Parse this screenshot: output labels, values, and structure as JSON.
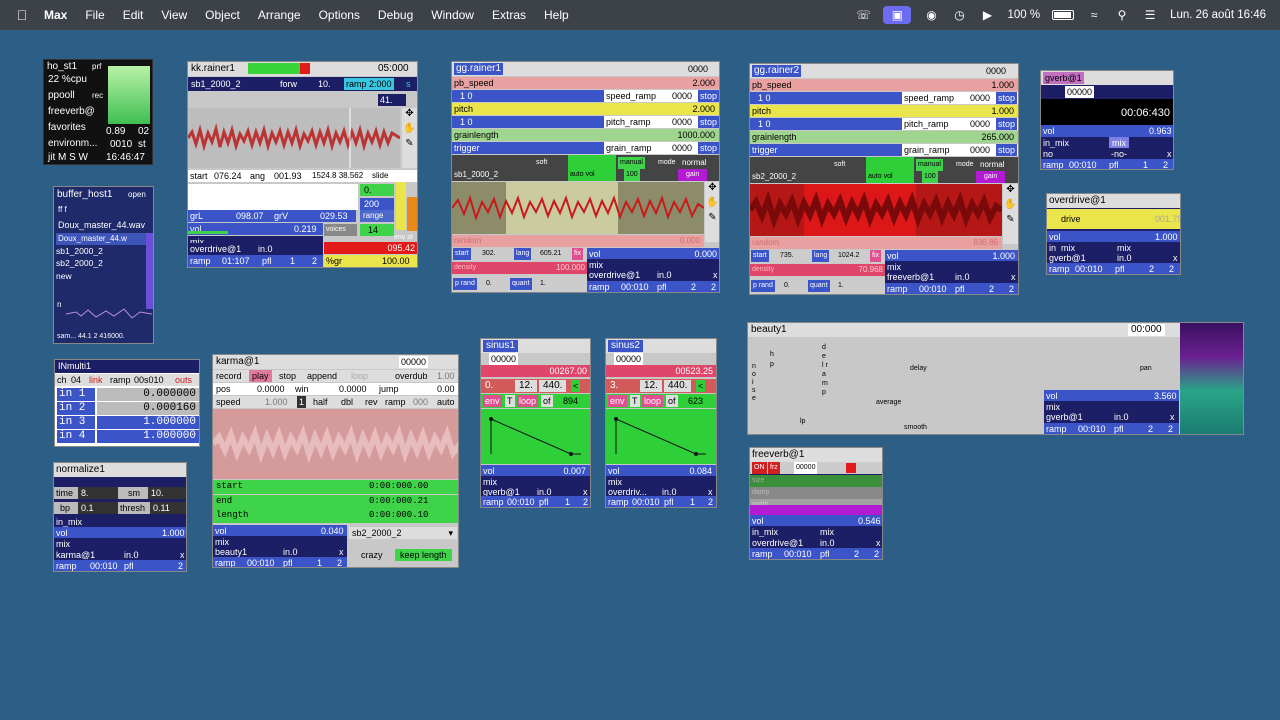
{
  "menubar": {
    "app": "Max",
    "items": [
      "File",
      "Edit",
      "View",
      "Object",
      "Arrange",
      "Options",
      "Debug",
      "Window",
      "Extras",
      "Help"
    ],
    "battery": "100 %",
    "datetime": "Lun. 26 août  16:46"
  },
  "host": {
    "name": "ho_st1",
    "cpu": "22 %cpu",
    "pr": "prf",
    "ppool": "ppooll",
    "rec": "rec",
    "fv": "freeverb@",
    "fav": "favorites",
    "env": "environm...",
    "jit": "jit M S W",
    "time": "16:46:47",
    "v1": "0.89",
    "v2": "02",
    "v3": "0010",
    "st": "st"
  },
  "buffer": {
    "title": "buffer_host1",
    "open": "open",
    "ff": "ff  f",
    "items": [
      "Doux_master_44.wav",
      "Doux_master_44.w",
      "sb1_2000_2",
      "sb2_2000_2",
      "new"
    ],
    "n": "n",
    "foot": "sam...  44.1  2  416000."
  },
  "kk": {
    "title": "kk.rainer1",
    "time": "05:000",
    "file": "sb1_2000_2",
    "dir": "forw",
    "n": "10.",
    "ramp": "ramp 2:000",
    "s": "s",
    "n41": "41.",
    "start": "start",
    "startv": "076.24",
    "ang": "ang",
    "angv": "001.93",
    "nums": "1524.8  38.562",
    "slide": "slide",
    "zero": "0.",
    "grL": "grL",
    "grLv": "098.07",
    "grV": "grV",
    "grVv": "029.53",
    "v200": "200",
    "range": "range",
    "vol": "vol",
    "volv": "0.219",
    "mix": "mix",
    "voices": "voices",
    "v14": "14",
    "od": "overdrive@1",
    "in0": "in.0",
    "ramp2": "ramp",
    "rampv": "01:107",
    "pfl": "pfl",
    "one": "1",
    "two": "2",
    "gr": "%gr",
    "grv": "100.00",
    "val95": "095.42",
    "env": "env  st"
  },
  "gg1": {
    "title": "gg.rainer1",
    "top": "0000",
    "pb": "pb_speed",
    "pbv": "2.000",
    "one": "1  0",
    "sr": "speed_ramp",
    "srv": "0000",
    "stop": "stop",
    "pitch": "pitch",
    "pitchv": "2.000",
    "pr": "pitch_ramp",
    "prv": "0000",
    "gl": "grainlength",
    "glv": "1000.000",
    "trig": "trigger",
    "gr": "grain_ramp",
    "grv": "0000",
    "soft": "soft",
    "manual": "manual",
    "mode": "mode",
    "normal": "normal",
    "file": "sb1_2000_2",
    "autovol": "auto vol",
    "v100": "100",
    "gain": "gain",
    "random": "random",
    "randv": "0.000",
    "start": "start",
    "startv": "302.",
    "lang": "lang",
    "langv": "605.21",
    "fix": "fix",
    "vol": "vol",
    "volv": "0.000",
    "density": "density",
    "dv": "100.000",
    "mix": "mix",
    "od": "overdrive@1",
    "in0": "in.0",
    "prand": "p rand",
    "pr0": "0.",
    "quant": "quant",
    "q1": "1.",
    "ramp": "ramp",
    "rampv": "00:010",
    "pfl": "pfl",
    "n2": "2",
    "x": "x"
  },
  "gg2": {
    "title": "gg.rainer2",
    "top": "0000",
    "pb": "pb_speed",
    "pbv": "1.000",
    "one": "1  0",
    "sr": "speed_ramp",
    "srv": "0000",
    "stop": "stop",
    "pitch": "pitch",
    "pitchv": "1.000",
    "pr": "pitch_ramp",
    "prv": "0000",
    "gl": "grainlength",
    "glv": "265.000",
    "trig": "trigger",
    "gr": "grain_ramp",
    "grv": "0000",
    "soft": "soft",
    "manual": "manual",
    "mode": "mode",
    "normal": "normal",
    "file": "sb2_2000_2",
    "autovol": "auto vol",
    "v100": "100",
    "gain": "gain",
    "random": "random",
    "randv": "836.86",
    "start": "start",
    "startv": "735.",
    "lang": "lang",
    "langv": "1024.2",
    "fix": "fix",
    "vol": "vol",
    "volv": "1.000",
    "density": "density",
    "dv": "70.968",
    "mix": "mix",
    "od": "freeverb@1",
    "in0": "in.0",
    "prand": "p rand",
    "pr0": "0.",
    "quant": "quant",
    "q1": "1.",
    "ramp": "ramp",
    "rampv": "00:010",
    "pfl": "pfl",
    "n2": "2",
    "x": "x"
  },
  "gverb": {
    "title": "gverb@1",
    "v1": "00000",
    "time": "00:06:430",
    "vol": "vol",
    "volv": "0.963",
    "inmix": "in_mix",
    "mix": "mix",
    "no": "no",
    "no2": "-no-",
    "x": "x",
    "ramp": "ramp",
    "rampv": "00:010",
    "pfl": "pfl",
    "n1": "1",
    "n2": "2"
  },
  "over": {
    "title": "overdrive@1",
    "drive": "drive",
    "dv": "001.79",
    "vol": "vol",
    "volv": "1.000",
    "inmix": "in_mix",
    "mix": "mix",
    "gv": "gverb@1",
    "in0": "in.0",
    "x": "x",
    "ramp": "ramp",
    "rampv": "00:010",
    "pfl": "pfl",
    "n1": "2",
    "n2": "2"
  },
  "inm": {
    "title": "INmulti1",
    "ch": "ch",
    "chv": "04",
    "link": "link",
    "ramp": "ramp",
    "rampv": "00s010",
    "outs": "outs",
    "ins": [
      {
        "l": "in 1",
        "v": "0.000000"
      },
      {
        "l": "in 2",
        "v": "0.000160"
      },
      {
        "l": "in 3",
        "v": "1.000000"
      },
      {
        "l": "in 4",
        "v": "1.000000"
      }
    ]
  },
  "norm": {
    "title": "normalize1",
    "time": "time",
    "timev": "8.",
    "sm": "sm",
    "smv": "10.",
    "bp": "bp",
    "bpv": "0.1",
    "thresh": "thresh",
    "threshv": "0.11",
    "inmix": "in_mix",
    "vol": "vol",
    "volv": "1.000",
    "mix": "mix",
    "dest": "karma@1",
    "in0": "in.0",
    "x": "x",
    "ramp": "ramp",
    "rampv": "00:010",
    "pfl": "pfl",
    "n2": "2"
  },
  "karma": {
    "title": "karma@1",
    "top": "00000",
    "record": "record",
    "play": "play",
    "stop": "stop",
    "append": "append",
    "loop": "loop",
    "overdub": "overdub",
    "ov": "1.00",
    "pos": "pos",
    "posv": "0.0000",
    "win": "win",
    "winv": "0.0000",
    "jump": "jump",
    "jumpv": "0.00",
    "speed": "speed",
    "speedv": "1.000",
    "one": "1",
    "half": "half",
    "dbl": "dbl",
    "rev": "rev",
    "ramp": "ramp",
    "rampv": "000",
    "auto": "auto",
    "start": "start",
    "startv": "0:00:000.00",
    "end": "end",
    "endv": "0:00:000.21",
    "length": "length",
    "lengthv": "0:00:000.10",
    "vol": "vol",
    "volv": "0.040",
    "mix": "mix",
    "dest": "beauty1",
    "in0": "in.0",
    "x": "x",
    "rampl": "ramp",
    "rampl2": "00:010",
    "pfl": "pfl",
    "n1": "1",
    "n2": "2",
    "file": "sb2_2000_2",
    "crazy": "crazy",
    "keep": "keep length"
  },
  "sin1": {
    "title": "sinus1",
    "v0": "00000",
    "v1": "00267.00",
    "a": "0.",
    "b": "12.",
    "c": "440.",
    "lt": "<",
    "env": "env",
    "T": "T",
    "loop": "loop",
    "of": "of",
    "n": "894",
    "vol": "vol",
    "volv": "0.007",
    "mix": "mix",
    "dest": "gverb@1",
    "in0": "in.0",
    "x": "x",
    "ramp": "ramp",
    "rampv": "00:010",
    "pfl": "pfl",
    "n1": "1",
    "n2": "2"
  },
  "sin2": {
    "title": "sinus2",
    "v0": "00000",
    "v1": "00523.25",
    "a": "3.",
    "b": "12.",
    "c": "440.",
    "lt": "<",
    "env": "env",
    "T": "T",
    "loop": "loop",
    "of": "of",
    "n": "623",
    "vol": "vol",
    "volv": "0.084",
    "mix": "mix",
    "dest": "overdriv...",
    "in0": "in.0",
    "x": "x",
    "ramp": "ramp",
    "rampv": "00:010",
    "pfl": "pfl",
    "n1": "1",
    "n2": "2"
  },
  "beauty": {
    "title": "beauty1",
    "time": "00:000",
    "l1": "h",
    "l2": "p",
    "l3": "n o i s e",
    "l4": "d e l r a m p",
    "delay": "delay",
    "pan": "pan",
    "average": "average",
    "lp": "lp",
    "smooth": "smooth",
    "vol": "vol",
    "volv": "3.560",
    "mix": "mix",
    "dest": "gverb@1",
    "in0": "in.0",
    "x": "x",
    "ramp": "ramp",
    "rampv": "00:010",
    "pfl": "pfl",
    "n1": "2",
    "n2": "2"
  },
  "fv": {
    "title": "freeverb@1",
    "on": "ON",
    "frz": "frz",
    "v": "00000",
    "size": "size",
    "damp": "damp",
    "width": "width",
    "vol": "vol",
    "volv": "0.546",
    "inmix": "in_mix",
    "mix": "mix",
    "dest": "overdrive@1",
    "in0": "in.0",
    "x": "x",
    "ramp": "ramp",
    "rampv": "00:010",
    "pfl": "pfl",
    "n1": "2",
    "n2": "2"
  }
}
